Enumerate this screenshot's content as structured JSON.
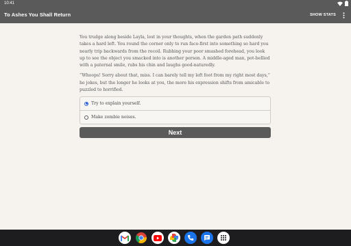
{
  "status_bar": {
    "time": "10:41"
  },
  "app_bar": {
    "title": "To Ashes You Shall Return",
    "show_stats_label": "SHOW STATS",
    "menu_icon": "more-vert-icon"
  },
  "story": {
    "paragraphs": [
      "You trudge along beside Layla, lost in your thoughts, when the garden path suddenly takes a hard left. You round the corner only to run face-first into something so hard you nearly trip backwards from the recoil. Rubbing your poor smashed forehead, you look up to see the object you smacked into is another person. A middle-aged man, pot-bellied with a paternal smile, rubs his chin and laughs good-naturedly.",
      "“Whoops! Sorry about that, miss. I can barely tell my left foot from my right most days,” he jokes, but the longer he looks at you, the more his expression shifts from amicable to puzzled to horrified."
    ]
  },
  "choices": [
    {
      "label": "Try to explain yourself.",
      "selected": true
    },
    {
      "label": "Make zombie noises.",
      "selected": false
    }
  ],
  "next_label": "Next",
  "taskbar": {
    "apps": [
      "gmail-icon",
      "chrome-icon",
      "youtube-icon",
      "photos-icon",
      "phone-icon",
      "messages-icon",
      "app-drawer-icon"
    ]
  },
  "colors": {
    "appbar": "#5a5a5a",
    "background": "#f6f3ef",
    "accent": "#2b5fd9",
    "taskbar": "#1d1d1f"
  }
}
